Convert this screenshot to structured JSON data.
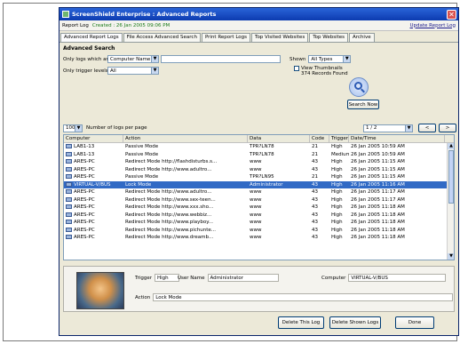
{
  "window": {
    "title": "ScreenShield Enterprise : Advanced Reports",
    "close_glyph": "✕"
  },
  "report_bar": {
    "label": "Report Log",
    "created": "Created : 26 Jan 2005 09:06 PM",
    "update_link": "Update Report Log"
  },
  "tabs": [
    {
      "label": "Advanced Report Logs"
    },
    {
      "label": "File Access Advanced Search"
    },
    {
      "label": "Print Report Logs"
    },
    {
      "label": "Top Visited Websites"
    },
    {
      "label": "Top Websites"
    },
    {
      "label": "Archive"
    }
  ],
  "advanced_search": {
    "title": "Advanced Search",
    "only_logs_label": "Only logs which are from",
    "field_value": "Computer Name",
    "field_text": "",
    "shown_label": "Shown",
    "shown_value": "All Types",
    "trigger_label": "Only trigger levels",
    "trigger_value": "All",
    "view_thumbnails": "View Thumbnails",
    "records_found": "374 Records Found",
    "search_now": "Search Now"
  },
  "paging": {
    "per_page_value": "100",
    "per_page_label": "Number of logs per page",
    "page_value": "1 / 2",
    "prev": "<",
    "next": ">"
  },
  "grid": {
    "columns": [
      "Computer",
      "Action",
      "Data",
      "Code",
      "Trigger",
      "Date/Time"
    ],
    "rows": [
      [
        "LAB1-13",
        "Passive Mode",
        "TPR?LN78",
        "21",
        "High",
        "26 Jan 2005 10:59 AM"
      ],
      [
        "LAB1-13",
        "Passive Mode",
        "TPR?LN78",
        "21",
        "Medium",
        "26 Jan 2005 10:59 AM"
      ],
      [
        "ARES-PC",
        "Redirect Mode http://flashdisturbs.s...",
        "www",
        "43",
        "High",
        "26 Jan 2005 11:15 AM"
      ],
      [
        "ARES-PC",
        "Redirect Mode http://www.adultro...",
        "www",
        "43",
        "High",
        "26 Jan 2005 11:15 AM"
      ],
      [
        "ARES-PC",
        "Passive Mode",
        "TPR?LN95",
        "21",
        "High",
        "26 Jan 2005 11:15 AM"
      ],
      [
        "VIRTUAL-V/BUS",
        "Lock Mode",
        "Administrator",
        "43",
        "High",
        "26 Jan 2005 11:16 AM"
      ],
      [
        "ARES-PC",
        "Redirect Mode http://www.adultro...",
        "www",
        "43",
        "High",
        "26 Jan 2005 11:17 AM"
      ],
      [
        "ARES-PC",
        "Redirect Mode http://www.sex-teen...",
        "www",
        "43",
        "High",
        "26 Jan 2005 11:17 AM"
      ],
      [
        "ARES-PC",
        "Redirect Mode http://www.xxx.sho...",
        "www",
        "43",
        "High",
        "26 Jan 2005 11:18 AM"
      ],
      [
        "ARES-PC",
        "Redirect Mode http://www.webbiz...",
        "www",
        "43",
        "High",
        "26 Jan 2005 11:18 AM"
      ],
      [
        "ARES-PC",
        "Redirect Mode http://www.playboy...",
        "www",
        "43",
        "High",
        "26 Jan 2005 11:18 AM"
      ],
      [
        "ARES-PC",
        "Redirect Mode http://www.pichunte...",
        "www",
        "43",
        "High",
        "26 Jan 2005 11:18 AM"
      ],
      [
        "ARES-PC",
        "Redirect Mode http://www.dreamb...",
        "www",
        "43",
        "High",
        "26 Jan 2005 11:18 AM"
      ]
    ],
    "selected_row": 5
  },
  "detail": {
    "trigger_label": "Trigger",
    "trigger_value": "High",
    "username_label": "User Name",
    "username_value": "Administrator",
    "computer_label": "Computer",
    "computer_value": "VIRTUAL-V/BUS",
    "action_label": "Action",
    "action_value": "Lock Mode"
  },
  "buttons": {
    "delete_log": "Delete This Log",
    "delete_shown": "Delete Shown Logs",
    "done": "Done"
  }
}
